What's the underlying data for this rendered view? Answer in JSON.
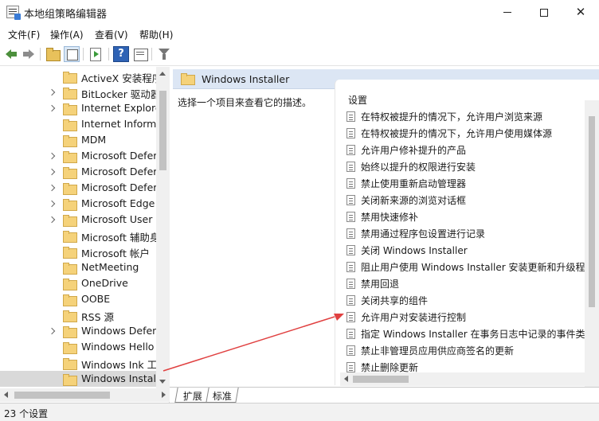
{
  "window": {
    "title": "本地组策略编辑器",
    "minimize_glyph": "",
    "close_glyph": "✕"
  },
  "menu": {
    "items": [
      "文件(F)",
      "操作(A)",
      "查看(V)",
      "帮助(H)"
    ]
  },
  "toolbar": {
    "help_glyph": "?"
  },
  "tree": {
    "items": [
      {
        "label": "ActiveX 安装程序",
        "expandable": false
      },
      {
        "label": "BitLocker 驱动器",
        "expandable": true
      },
      {
        "label": "Internet Explore",
        "expandable": true
      },
      {
        "label": "Internet Informa",
        "expandable": false
      },
      {
        "label": "MDM",
        "expandable": false
      },
      {
        "label": "Microsoft Defer",
        "expandable": true
      },
      {
        "label": "Microsoft Defer",
        "expandable": true
      },
      {
        "label": "Microsoft Defer",
        "expandable": true
      },
      {
        "label": "Microsoft Edge",
        "expandable": true
      },
      {
        "label": "Microsoft User",
        "expandable": true
      },
      {
        "label": "Microsoft 辅助身",
        "expandable": false
      },
      {
        "label": "Microsoft 帐户",
        "expandable": false
      },
      {
        "label": "NetMeeting",
        "expandable": false
      },
      {
        "label": "OneDrive",
        "expandable": false
      },
      {
        "label": "OOBE",
        "expandable": false
      },
      {
        "label": "RSS 源",
        "expandable": false
      },
      {
        "label": "Windows Defen",
        "expandable": true
      },
      {
        "label": "Windows Hello",
        "expandable": false
      },
      {
        "label": "Windows Ink 工",
        "expandable": false
      },
      {
        "label": "Windows Install",
        "expandable": false,
        "selected": true
      }
    ]
  },
  "right_panel": {
    "header_title": "Windows Installer",
    "description_hint": "选择一个项目来查看它的描述。",
    "settings_column_header": "设置",
    "settings": [
      "在特权被提升的情况下，允许用户浏览来源",
      "在特权被提升的情况下，允许用户使用媒体源",
      "允许用户修补提升的产品",
      "始终以提升的权限进行安装",
      "禁止使用重新启动管理器",
      "关闭新来源的浏览对话框",
      "禁用快速修补",
      "禁用通过程序包设置进行记录",
      "关闭 Windows Installer",
      "阻止用户使用 Windows Installer 安装更新和升级程",
      "禁用回退",
      "关闭共享的组件",
      "允许用户对安装进行控制",
      "指定 Windows Installer 在事务日志中记录的事件类",
      "禁止非管理员应用供应商签名的更新",
      "禁止删除更新"
    ]
  },
  "tabs": [
    "扩展",
    "标准"
  ],
  "status": {
    "text": "23 个设置"
  },
  "colors": {
    "annotation_arrow": "#e04040",
    "header_background": "#dce6f4",
    "selected_row": "#d9d9d9"
  }
}
